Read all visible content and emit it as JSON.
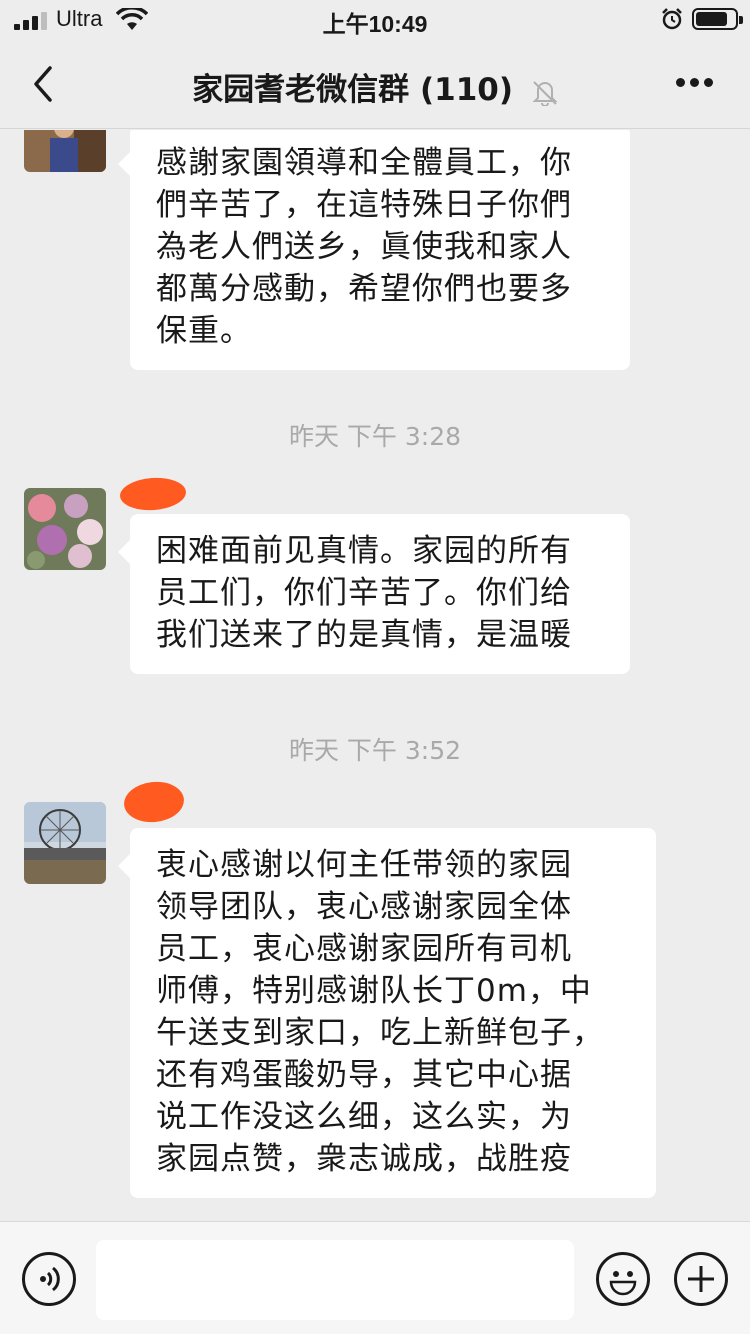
{
  "status_bar": {
    "carrier": "Ultra",
    "time": "上午10:49",
    "battery_level": 0.85,
    "signal_bars": 3
  },
  "header": {
    "title": "家园耆老微信群 (110)",
    "back_icon": "chevron-left-icon",
    "mute_icon": "bell-muted-icon",
    "more_icon": "more-dots-icon"
  },
  "messages": [
    {
      "lines": [
        "感謝家園領導和全體員工，你",
        "們辛苦了，在這特殊日子你們",
        "為老人們送乡，眞使我和家人",
        "都萬分感動，希望你們也要多",
        "保重。"
      ]
    },
    {
      "timestamp": "昨天 下午 3:28",
      "lines": [
        "困难面前见真情。家园的所有",
        "员工们，你们辛苦了。你们给",
        "我们送来了的是真情，是温暖"
      ]
    },
    {
      "timestamp": "昨天 下午 3:52",
      "lines": [
        "衷心感谢以何主任带领的家园",
        "领导团队，衷心感谢家园全体",
        "员工，衷心感谢家园所有司机",
        "师傅，特别感谢队长丁0m，中",
        "午送支到家口，吃上新鲜包子，",
        "还有鸡蛋酸奶导，其它中心据",
        "说工作没这么细，这么实，为",
        "家园点赞，衆志诚成，战胜疫"
      ]
    }
  ],
  "input_bar": {
    "voice_icon": "voice-icon",
    "emoji_icon": "emoji-icon",
    "plus_icon": "plus-icon",
    "input_value": ""
  },
  "colors": {
    "background": "#ededed",
    "bubble": "#ffffff",
    "redaction": "#ff5a1f",
    "timestamp": "#a9a9a9"
  }
}
